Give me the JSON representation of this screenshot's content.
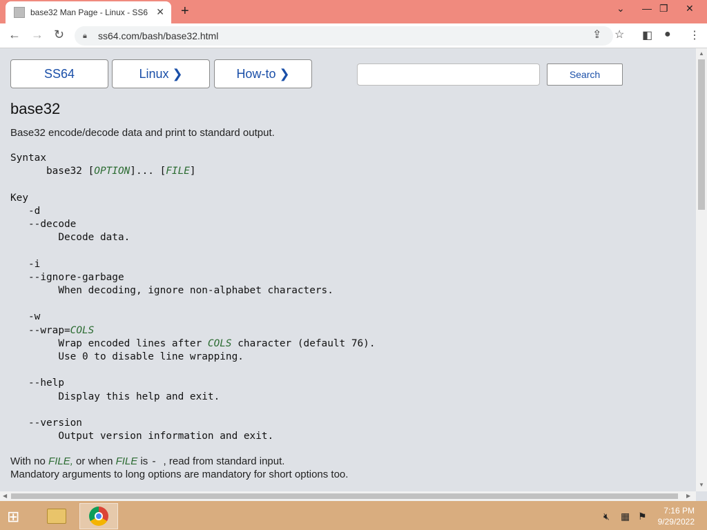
{
  "browser": {
    "tab_title": "base32 Man Page - Linux - SS64",
    "tab_close": "✕",
    "new_tab": "+",
    "url": "ss64.com/bash/base32.html",
    "window_minimize": "⌄",
    "window_min2": "—",
    "window_restore": "❐",
    "window_close": "✕"
  },
  "site_nav": {
    "ss64": "SS64",
    "linux": "Linux ❯",
    "howto": "How-to ❯",
    "search_label": "Search",
    "search_value": ""
  },
  "page": {
    "title": "base32",
    "description": "Base32 encode/decode data and print to standard output.",
    "syntax_label": "Syntax",
    "syntax_cmd": "base32 [",
    "syntax_option": "OPTION",
    "syntax_mid": "]... [",
    "syntax_file": "FILE",
    "syntax_end": "]",
    "key_label": "Key",
    "opt_d": "-d",
    "opt_decode": "--decode",
    "opt_decode_desc": "Decode data.",
    "opt_i": "-i",
    "opt_ignore": "--ignore-garbage",
    "opt_ignore_desc": "When decoding, ignore non-alphabet characters.",
    "opt_w": "-w",
    "opt_wrap": "--wrap=",
    "opt_wrap_cols": "COLS",
    "opt_wrap_desc1a": "Wrap encoded lines after ",
    "opt_wrap_desc1b": "COLS",
    "opt_wrap_desc1c": " character (default 76).",
    "opt_wrap_desc2": "Use 0 to disable line wrapping.",
    "opt_help": "--help",
    "opt_help_desc": "Display this help and exit.",
    "opt_version": "--version",
    "opt_version_desc": "Output version information and exit.",
    "foot1_a": "With no ",
    "foot1_file": "FILE,",
    "foot1_b": " or when ",
    "foot1_file2": "FILE",
    "foot1_c": " is ",
    "foot1_dash": " - ",
    "foot1_d": ", read from standard input.",
    "foot2": "Mandatory arguments to long options are mandatory for short options too."
  },
  "taskbar": {
    "time": "7:16 PM",
    "date": "9/29/2022"
  }
}
